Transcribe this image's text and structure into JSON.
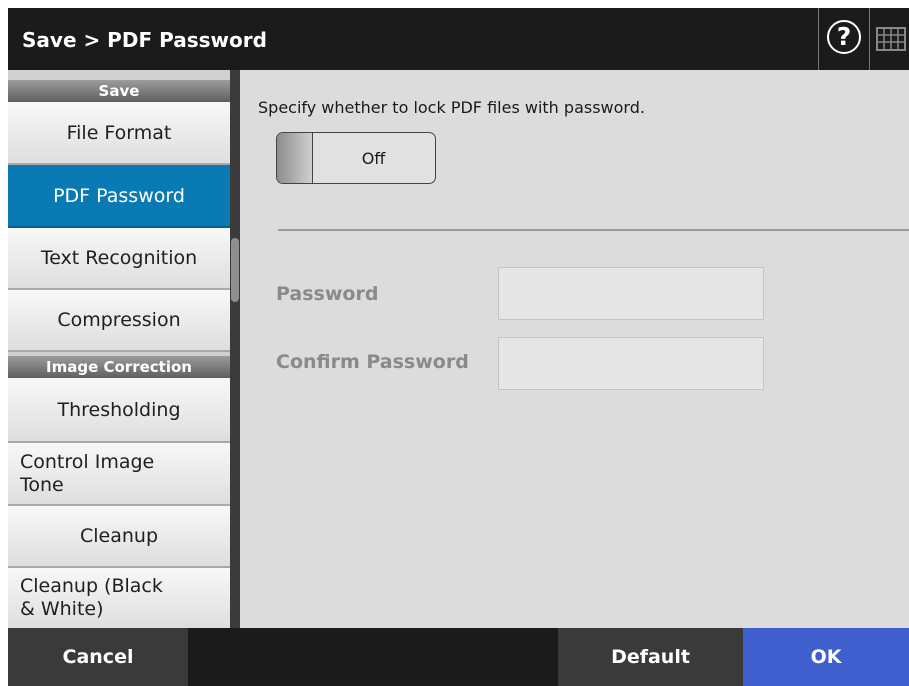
{
  "titlebar": {
    "title": "Save > PDF Password",
    "help_icon": "question-circle-icon",
    "help_glyph": "?",
    "keyboard_icon": "keyboard-icon"
  },
  "sidebar": {
    "sections": [
      {
        "header": "Save",
        "items": [
          {
            "label": "File Format",
            "active": false
          },
          {
            "label": "PDF Password",
            "active": true
          },
          {
            "label": "Text Recognition",
            "active": false
          },
          {
            "label": "Compression",
            "active": false
          }
        ]
      },
      {
        "header": "Image Correction",
        "items": [
          {
            "label": "Thresholding",
            "active": false
          },
          {
            "label": "Control Image Tone",
            "active": false
          },
          {
            "label": "Cleanup",
            "active": false
          },
          {
            "label": "Cleanup (Black & White)",
            "active": false
          }
        ]
      }
    ]
  },
  "content": {
    "instruction": "Specify whether to lock PDF files with password.",
    "toggle": {
      "label": "Off",
      "state": "off"
    },
    "password_label": "Password",
    "password_value": "",
    "confirm_label": "Confirm Password",
    "confirm_value": ""
  },
  "footer": {
    "cancel": "Cancel",
    "default": "Default",
    "ok": "OK"
  },
  "colors": {
    "active_item": "#0a7ab4",
    "ok_button": "#3f5fce",
    "titlebar": "#1b1b1b"
  }
}
